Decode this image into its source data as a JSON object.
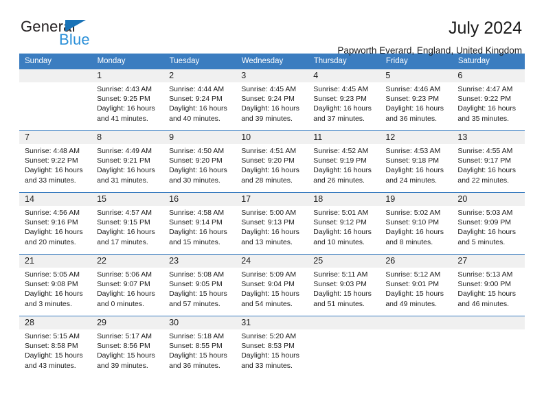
{
  "brand": {
    "name_part1": "General",
    "name_part2": "Blue",
    "triangle_color": "#1a73b7",
    "blue_color": "#2a8fd8"
  },
  "header": {
    "title": "July 2024",
    "location": "Papworth Everard, England, United Kingdom"
  },
  "theme": {
    "header_blue": "#3b7dc0",
    "daynum_band": "#f0f0f0",
    "text": "#1a1a1a"
  },
  "weekday_headers": [
    "Sunday",
    "Monday",
    "Tuesday",
    "Wednesday",
    "Thursday",
    "Friday",
    "Saturday"
  ],
  "weeks": [
    [
      {
        "day": "",
        "sunrise": "",
        "sunset": "",
        "daylight_line1": "",
        "daylight_line2": ""
      },
      {
        "day": "1",
        "sunrise": "Sunrise: 4:43 AM",
        "sunset": "Sunset: 9:25 PM",
        "daylight_line1": "Daylight: 16 hours",
        "daylight_line2": "and 41 minutes."
      },
      {
        "day": "2",
        "sunrise": "Sunrise: 4:44 AM",
        "sunset": "Sunset: 9:24 PM",
        "daylight_line1": "Daylight: 16 hours",
        "daylight_line2": "and 40 minutes."
      },
      {
        "day": "3",
        "sunrise": "Sunrise: 4:45 AM",
        "sunset": "Sunset: 9:24 PM",
        "daylight_line1": "Daylight: 16 hours",
        "daylight_line2": "and 39 minutes."
      },
      {
        "day": "4",
        "sunrise": "Sunrise: 4:45 AM",
        "sunset": "Sunset: 9:23 PM",
        "daylight_line1": "Daylight: 16 hours",
        "daylight_line2": "and 37 minutes."
      },
      {
        "day": "5",
        "sunrise": "Sunrise: 4:46 AM",
        "sunset": "Sunset: 9:23 PM",
        "daylight_line1": "Daylight: 16 hours",
        "daylight_line2": "and 36 minutes."
      },
      {
        "day": "6",
        "sunrise": "Sunrise: 4:47 AM",
        "sunset": "Sunset: 9:22 PM",
        "daylight_line1": "Daylight: 16 hours",
        "daylight_line2": "and 35 minutes."
      }
    ],
    [
      {
        "day": "7",
        "sunrise": "Sunrise: 4:48 AM",
        "sunset": "Sunset: 9:22 PM",
        "daylight_line1": "Daylight: 16 hours",
        "daylight_line2": "and 33 minutes."
      },
      {
        "day": "8",
        "sunrise": "Sunrise: 4:49 AM",
        "sunset": "Sunset: 9:21 PM",
        "daylight_line1": "Daylight: 16 hours",
        "daylight_line2": "and 31 minutes."
      },
      {
        "day": "9",
        "sunrise": "Sunrise: 4:50 AM",
        "sunset": "Sunset: 9:20 PM",
        "daylight_line1": "Daylight: 16 hours",
        "daylight_line2": "and 30 minutes."
      },
      {
        "day": "10",
        "sunrise": "Sunrise: 4:51 AM",
        "sunset": "Sunset: 9:20 PM",
        "daylight_line1": "Daylight: 16 hours",
        "daylight_line2": "and 28 minutes."
      },
      {
        "day": "11",
        "sunrise": "Sunrise: 4:52 AM",
        "sunset": "Sunset: 9:19 PM",
        "daylight_line1": "Daylight: 16 hours",
        "daylight_line2": "and 26 minutes."
      },
      {
        "day": "12",
        "sunrise": "Sunrise: 4:53 AM",
        "sunset": "Sunset: 9:18 PM",
        "daylight_line1": "Daylight: 16 hours",
        "daylight_line2": "and 24 minutes."
      },
      {
        "day": "13",
        "sunrise": "Sunrise: 4:55 AM",
        "sunset": "Sunset: 9:17 PM",
        "daylight_line1": "Daylight: 16 hours",
        "daylight_line2": "and 22 minutes."
      }
    ],
    [
      {
        "day": "14",
        "sunrise": "Sunrise: 4:56 AM",
        "sunset": "Sunset: 9:16 PM",
        "daylight_line1": "Daylight: 16 hours",
        "daylight_line2": "and 20 minutes."
      },
      {
        "day": "15",
        "sunrise": "Sunrise: 4:57 AM",
        "sunset": "Sunset: 9:15 PM",
        "daylight_line1": "Daylight: 16 hours",
        "daylight_line2": "and 17 minutes."
      },
      {
        "day": "16",
        "sunrise": "Sunrise: 4:58 AM",
        "sunset": "Sunset: 9:14 PM",
        "daylight_line1": "Daylight: 16 hours",
        "daylight_line2": "and 15 minutes."
      },
      {
        "day": "17",
        "sunrise": "Sunrise: 5:00 AM",
        "sunset": "Sunset: 9:13 PM",
        "daylight_line1": "Daylight: 16 hours",
        "daylight_line2": "and 13 minutes."
      },
      {
        "day": "18",
        "sunrise": "Sunrise: 5:01 AM",
        "sunset": "Sunset: 9:12 PM",
        "daylight_line1": "Daylight: 16 hours",
        "daylight_line2": "and 10 minutes."
      },
      {
        "day": "19",
        "sunrise": "Sunrise: 5:02 AM",
        "sunset": "Sunset: 9:10 PM",
        "daylight_line1": "Daylight: 16 hours",
        "daylight_line2": "and 8 minutes."
      },
      {
        "day": "20",
        "sunrise": "Sunrise: 5:03 AM",
        "sunset": "Sunset: 9:09 PM",
        "daylight_line1": "Daylight: 16 hours",
        "daylight_line2": "and 5 minutes."
      }
    ],
    [
      {
        "day": "21",
        "sunrise": "Sunrise: 5:05 AM",
        "sunset": "Sunset: 9:08 PM",
        "daylight_line1": "Daylight: 16 hours",
        "daylight_line2": "and 3 minutes."
      },
      {
        "day": "22",
        "sunrise": "Sunrise: 5:06 AM",
        "sunset": "Sunset: 9:07 PM",
        "daylight_line1": "Daylight: 16 hours",
        "daylight_line2": "and 0 minutes."
      },
      {
        "day": "23",
        "sunrise": "Sunrise: 5:08 AM",
        "sunset": "Sunset: 9:05 PM",
        "daylight_line1": "Daylight: 15 hours",
        "daylight_line2": "and 57 minutes."
      },
      {
        "day": "24",
        "sunrise": "Sunrise: 5:09 AM",
        "sunset": "Sunset: 9:04 PM",
        "daylight_line1": "Daylight: 15 hours",
        "daylight_line2": "and 54 minutes."
      },
      {
        "day": "25",
        "sunrise": "Sunrise: 5:11 AM",
        "sunset": "Sunset: 9:03 PM",
        "daylight_line1": "Daylight: 15 hours",
        "daylight_line2": "and 51 minutes."
      },
      {
        "day": "26",
        "sunrise": "Sunrise: 5:12 AM",
        "sunset": "Sunset: 9:01 PM",
        "daylight_line1": "Daylight: 15 hours",
        "daylight_line2": "and 49 minutes."
      },
      {
        "day": "27",
        "sunrise": "Sunrise: 5:13 AM",
        "sunset": "Sunset: 9:00 PM",
        "daylight_line1": "Daylight: 15 hours",
        "daylight_line2": "and 46 minutes."
      }
    ],
    [
      {
        "day": "28",
        "sunrise": "Sunrise: 5:15 AM",
        "sunset": "Sunset: 8:58 PM",
        "daylight_line1": "Daylight: 15 hours",
        "daylight_line2": "and 43 minutes."
      },
      {
        "day": "29",
        "sunrise": "Sunrise: 5:17 AM",
        "sunset": "Sunset: 8:56 PM",
        "daylight_line1": "Daylight: 15 hours",
        "daylight_line2": "and 39 minutes."
      },
      {
        "day": "30",
        "sunrise": "Sunrise: 5:18 AM",
        "sunset": "Sunset: 8:55 PM",
        "daylight_line1": "Daylight: 15 hours",
        "daylight_line2": "and 36 minutes."
      },
      {
        "day": "31",
        "sunrise": "Sunrise: 5:20 AM",
        "sunset": "Sunset: 8:53 PM",
        "daylight_line1": "Daylight: 15 hours",
        "daylight_line2": "and 33 minutes."
      },
      {
        "day": "",
        "sunrise": "",
        "sunset": "",
        "daylight_line1": "",
        "daylight_line2": ""
      },
      {
        "day": "",
        "sunrise": "",
        "sunset": "",
        "daylight_line1": "",
        "daylight_line2": ""
      },
      {
        "day": "",
        "sunrise": "",
        "sunset": "",
        "daylight_line1": "",
        "daylight_line2": ""
      }
    ]
  ]
}
